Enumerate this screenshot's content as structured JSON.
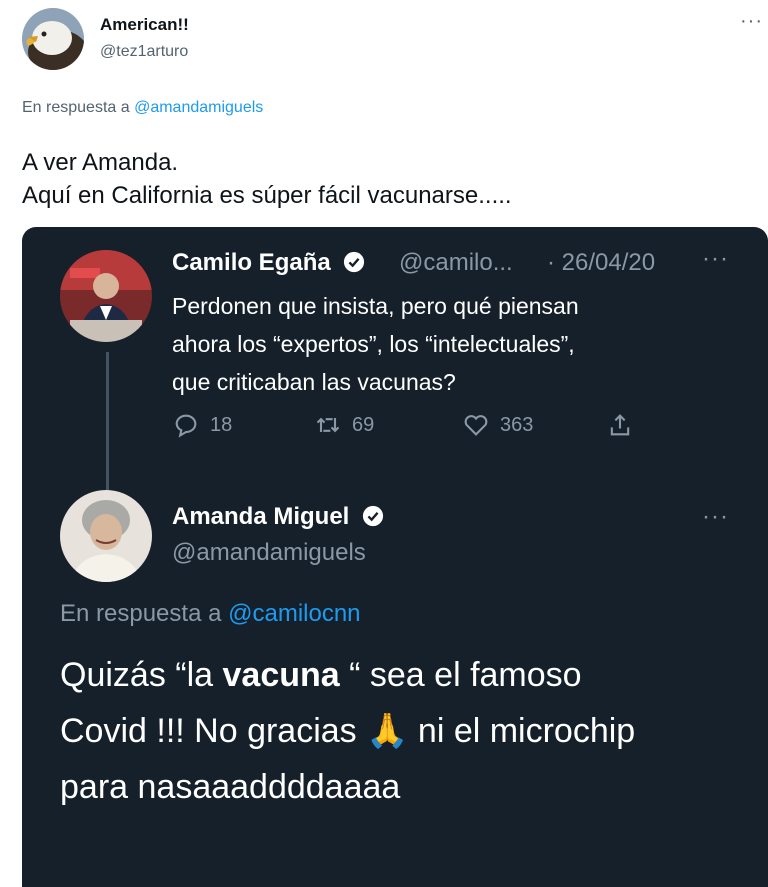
{
  "outer": {
    "display_name": "American!!",
    "handle": "@tez1arturo",
    "reply_prefix": "En respuesta a",
    "reply_mention": "@amandamiguels",
    "text_line1": "A ver Amanda.",
    "text_line2": "Aquí en California es súper fácil vacunarse....."
  },
  "quoted": {
    "tweet1": {
      "name": "Camilo Egaña",
      "handle": "@camilo...",
      "date": "· 26/04/20",
      "text_line1": "Perdonen que insista, pero qué piensan",
      "text_line2": "ahora los “expertos”, los “intelectuales”,",
      "text_line3": "que criticaban las vacunas?",
      "replies": "18",
      "retweets": "69",
      "likes": "363"
    },
    "tweet2": {
      "name": "Amanda Miguel",
      "handle": "@amandamiguels",
      "reply_prefix": "En respuesta a",
      "reply_mention": "@camilocnn",
      "text_a": "Quizás “la ",
      "text_bold": "vacuna",
      "text_b": " “ sea el famoso",
      "text_line2a": "Covid !!! No gracias ",
      "emoji": "🙏",
      "text_line2b": " ni el microchip",
      "text_line3": "para nasaaaddddaaaa"
    }
  },
  "icons": [
    "eagle-avatar",
    "more-icon",
    "verified-icon",
    "reply-icon",
    "retweet-icon",
    "like-icon",
    "share-icon"
  ],
  "colors": {
    "accent": "#1d9bf0",
    "dark_bg": "#15202b",
    "muted": "#8b98a5"
  }
}
